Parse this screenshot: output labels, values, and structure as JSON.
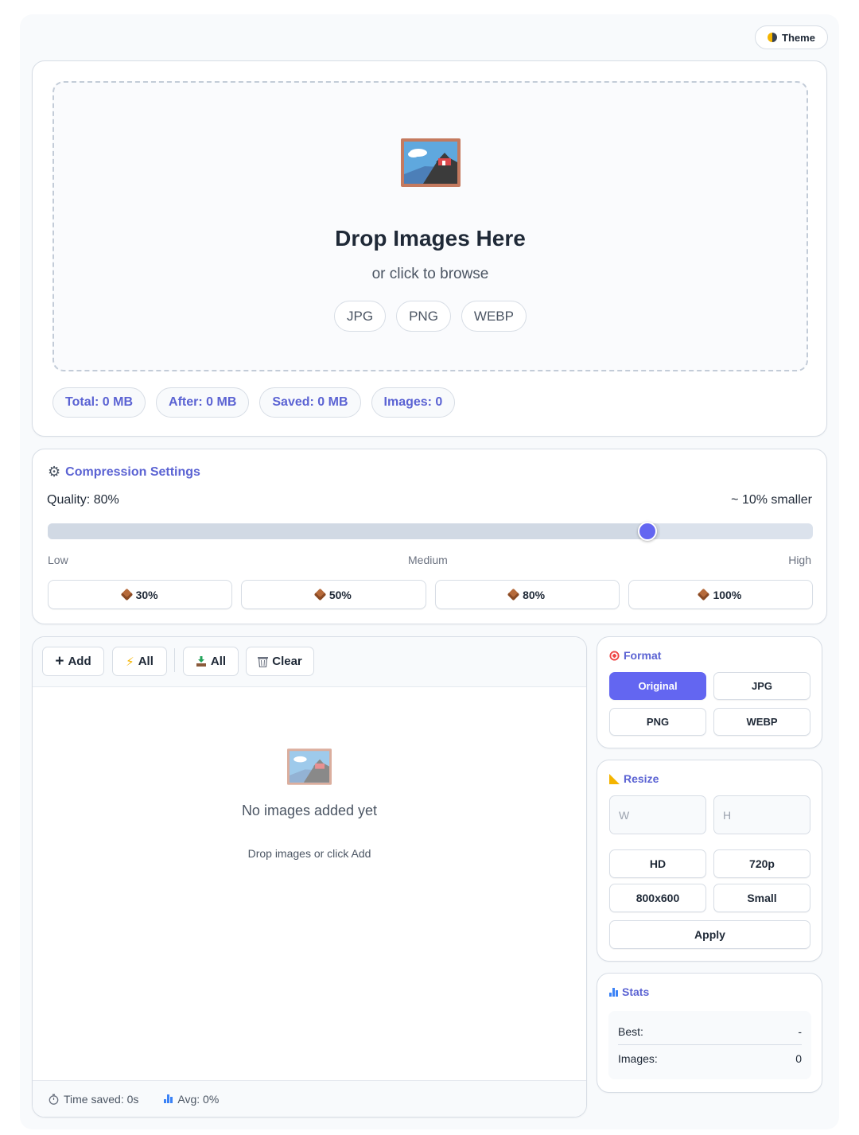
{
  "header": {
    "theme_label": "Theme",
    "theme_icon": "half-moon-icon"
  },
  "upload": {
    "title": "Drop Images Here",
    "subtitle": "or click to browse",
    "formats": [
      "JPG",
      "PNG",
      "WEBP"
    ],
    "stats": {
      "total": "Total: 0 MB",
      "after": "After: 0 MB",
      "saved": "Saved: 0 MB",
      "images": "Images: 0"
    }
  },
  "compression": {
    "title": "Compression Settings",
    "quality_label": "Quality: 80%",
    "estimate": "~ 10% smaller",
    "quality_value": 80,
    "levels": {
      "low": "Low",
      "medium": "Medium",
      "high": "High"
    },
    "presets": [
      "30%",
      "50%",
      "80%",
      "100%"
    ]
  },
  "toolbar": {
    "add": "Add",
    "compress_all": "All",
    "download_all": "All",
    "clear": "Clear"
  },
  "empty_state": {
    "title": "No images added yet",
    "subtitle": "Drop images or click Add"
  },
  "footer": {
    "time_saved": "Time saved: 0s",
    "avg": "Avg: 0%"
  },
  "format_panel": {
    "title": "Format",
    "options": [
      "Original",
      "JPG",
      "PNG",
      "WEBP"
    ],
    "selected": "Original"
  },
  "resize_panel": {
    "title": "Resize",
    "width_placeholder": "W",
    "height_placeholder": "H",
    "presets": [
      "HD",
      "720p",
      "800x600",
      "Small"
    ],
    "apply": "Apply"
  },
  "stats_panel": {
    "title": "Stats",
    "best_label": "Best:",
    "best_value": "-",
    "images_label": "Images:",
    "images_value": "0"
  },
  "colors": {
    "accent": "#6366f1",
    "accent_text": "#5b63d3",
    "border": "#d7dde5"
  }
}
